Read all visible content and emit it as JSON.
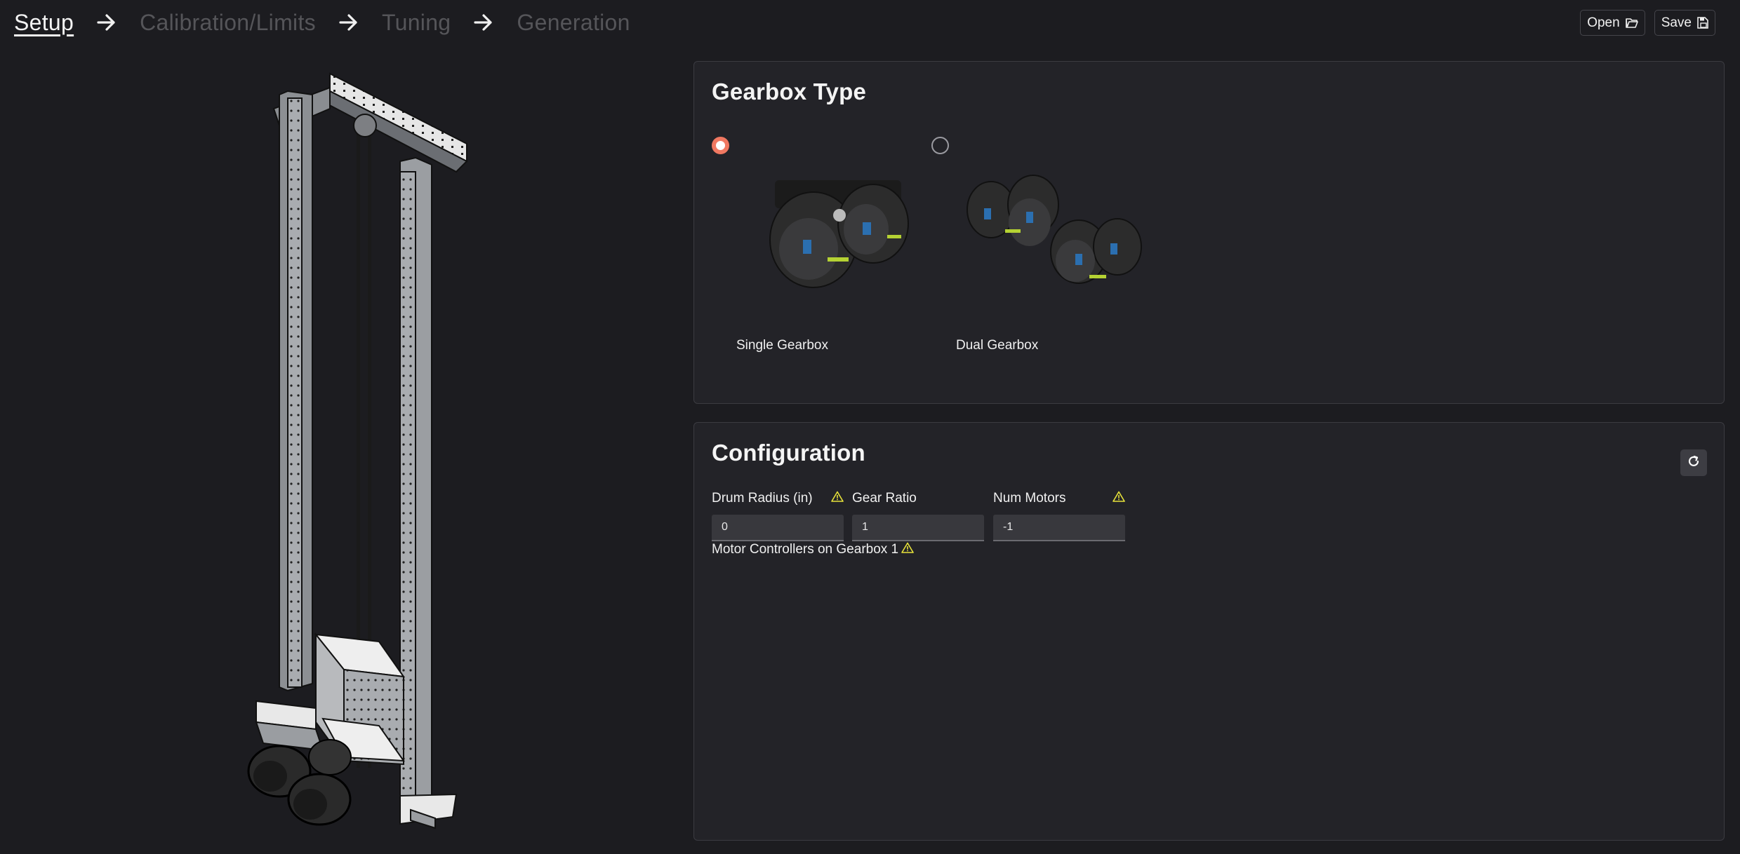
{
  "nav": {
    "steps": [
      {
        "label": "Setup"
      },
      {
        "label": "Calibration/Limits"
      },
      {
        "label": "Tuning"
      },
      {
        "label": "Generation"
      }
    ]
  },
  "toolbar": {
    "open_label": "Open",
    "save_label": "Save"
  },
  "gearbox_panel": {
    "title": "Gearbox Type",
    "options": [
      {
        "label": "Single Gearbox",
        "selected": true
      },
      {
        "label": "Dual Gearbox",
        "selected": false
      }
    ]
  },
  "config_panel": {
    "title": "Configuration",
    "fields": [
      {
        "label": "Drum Radius (in)",
        "value": "0",
        "warning": true
      },
      {
        "label": "Gear Ratio",
        "value": "1",
        "warning": false
      },
      {
        "label": "Num Motors",
        "value": "-1",
        "warning": true
      }
    ],
    "motor_controllers_label": "Motor Controllers on Gearbox 1",
    "motor_controllers_warning": true
  },
  "colors": {
    "accent": "#f07861",
    "warning": "#e7e23a",
    "background": "#1c1c20",
    "panel": "#232328"
  }
}
